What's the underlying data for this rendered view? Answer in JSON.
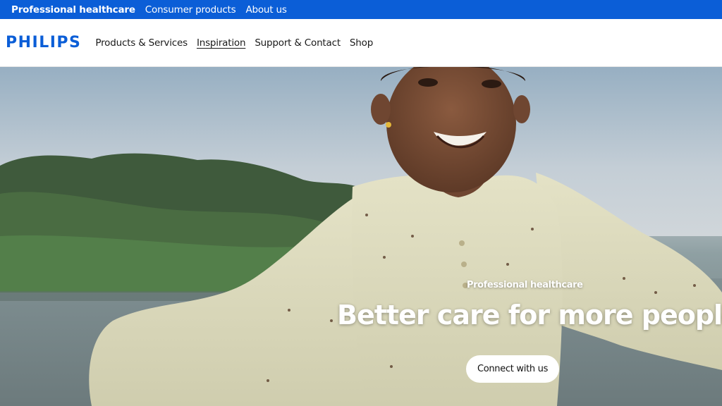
{
  "utility_bar": {
    "links": [
      {
        "label": "Professional healthcare",
        "active": true
      },
      {
        "label": "Consumer products",
        "active": false
      },
      {
        "label": "About us",
        "active": false
      }
    ]
  },
  "main_nav": {
    "logo": "PHILIPS",
    "links": [
      {
        "label": "Products & Services"
      },
      {
        "label": "Inspiration",
        "current": true
      },
      {
        "label": "Support & Contact"
      },
      {
        "label": "Shop"
      }
    ]
  },
  "hero": {
    "eyebrow": "Professional healthcare",
    "title": "Better care for more people",
    "cta_label": "Connect with us"
  },
  "colors": {
    "brand_blue": "#0b5ed7",
    "white": "#ffffff"
  }
}
